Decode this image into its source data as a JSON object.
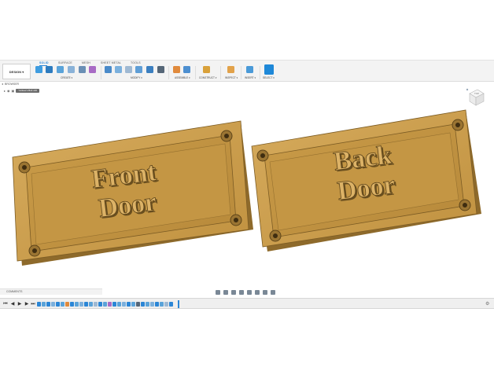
{
  "toolbar": {
    "workspace": "DESIGN ▾",
    "tabs": [
      {
        "label": "SOLID",
        "active": true
      },
      {
        "label": "SURFACE",
        "active": false
      },
      {
        "label": "MESH",
        "active": false
      },
      {
        "label": "SHEET METAL",
        "active": false
      },
      {
        "label": "TOOLS",
        "active": false
      }
    ],
    "groups": [
      "CREATE ▾",
      "MODIFY ▾",
      "ASSEMBLE ▾",
      "CONSTRUCT ▾",
      "INSPECT ▾",
      "INSERT ▾",
      "SELECT ▾"
    ],
    "accent": "#2b86d6"
  },
  "browser": {
    "label": "BROWSER",
    "document": "Yankee's Bolt v26"
  },
  "viewcube": {
    "face": "TOP"
  },
  "scene": {
    "plaque_color": "#c79a4a",
    "plates": [
      {
        "line1": "Front",
        "line2": "Door"
      },
      {
        "line1": "Back",
        "line2": "Door"
      }
    ]
  },
  "comments": {
    "label": "COMMENTS"
  }
}
